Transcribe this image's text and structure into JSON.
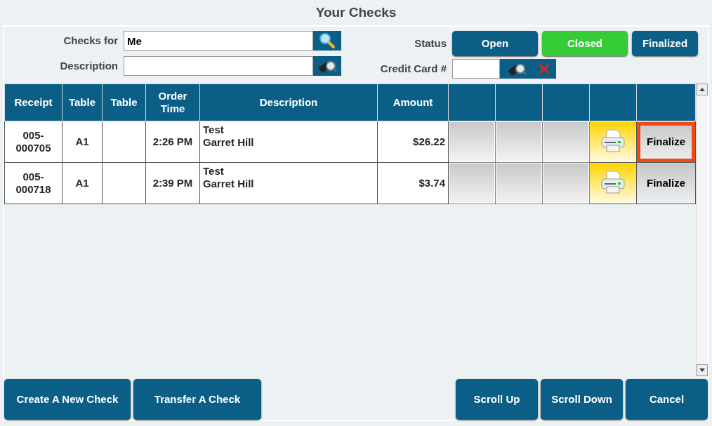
{
  "title": "Your Checks",
  "filters": {
    "checks_for": {
      "label": "Checks for",
      "value": "Me"
    },
    "description": {
      "label": "Description"
    },
    "status": {
      "label": "Status",
      "options": [
        {
          "label": "Open",
          "selected": false
        },
        {
          "label": "Closed",
          "selected": true
        },
        {
          "label": "Finalized",
          "selected": false
        }
      ]
    },
    "credit_card": {
      "label": "Credit Card #"
    }
  },
  "table": {
    "columns": [
      "Receipt",
      "Table",
      "Table",
      "Order Time",
      "Description",
      "Amount"
    ],
    "rows": [
      {
        "receipt": "005-\n000705",
        "table": "A1",
        "order_time": "2:26 PM",
        "description": "Test\nGarret Hill",
        "amount": "$26.22",
        "action": "Finalize",
        "highlighted": true
      },
      {
        "receipt": "005-\n000718",
        "table": "A1",
        "order_time": "2:39 PM",
        "description": "Test\nGarret Hill",
        "amount": "$3.74",
        "action": "Finalize",
        "highlighted": false
      }
    ]
  },
  "buttons_left": [
    "Create A New Check",
    "Transfer A Check"
  ],
  "buttons_right": [
    "Scroll Up",
    "Scroll Down",
    "Cancel"
  ]
}
